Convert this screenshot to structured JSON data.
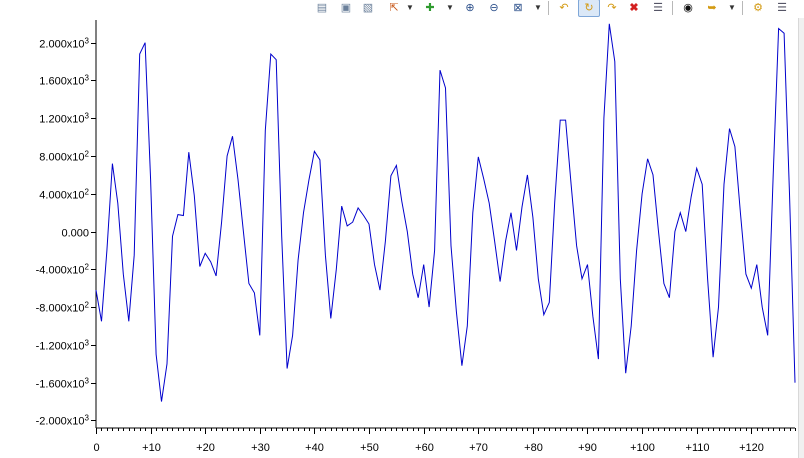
{
  "toolbar": {
    "icons": [
      "align-left-icon",
      "align-center-icon",
      "align-bottom-icon",
      "cursor-icon",
      "add-icon",
      "zoom-in-icon",
      "zoom-out-icon",
      "zoom-fit-icon",
      "undo-icon",
      "refresh-icon",
      "delete-icon",
      "list-icon",
      "binoculars-icon",
      "export-icon",
      "options-icon"
    ]
  },
  "colors": {
    "series": "#0000cc",
    "axis": "#000000"
  },
  "chart_data": {
    "type": "line",
    "xlim": [
      0,
      128
    ],
    "ylim": [
      -2080,
      2240
    ],
    "x_ticks": [
      0,
      10,
      20,
      30,
      40,
      50,
      60,
      70,
      80,
      90,
      100,
      110,
      120
    ],
    "x_tick_labels": [
      "0",
      "+10",
      "+20",
      "+30",
      "+40",
      "+50",
      "+60",
      "+70",
      "+80",
      "+90",
      "+100",
      "+110",
      "+120"
    ],
    "y_ticks": [
      2000,
      1600,
      1200,
      800,
      400,
      0,
      -400,
      -800,
      -1200,
      -1600,
      -2000
    ],
    "y_tick_labels": [
      {
        "m": "2.000x10",
        "e": "3"
      },
      {
        "m": "1.600x10",
        "e": "3"
      },
      {
        "m": "1.200x10",
        "e": "3"
      },
      {
        "m": "8.000x10",
        "e": "2"
      },
      {
        "m": "4.000x10",
        "e": "2"
      },
      {
        "m": "0.000",
        "e": ""
      },
      {
        "m": "-4.000x10",
        "e": "2"
      },
      {
        "m": "-8.000x10",
        "e": "2"
      },
      {
        "m": "-1.200x10",
        "e": "3"
      },
      {
        "m": "-1.600x10",
        "e": "3"
      },
      {
        "m": "-2.000x10",
        "e": "3"
      }
    ],
    "series": [
      {
        "values": [
          -620,
          -950,
          -200,
          720,
          300,
          -450,
          -950,
          -250,
          1880,
          2000,
          550,
          -1300,
          -1800,
          -1400,
          -50,
          180,
          170,
          840,
          380,
          -370,
          -230,
          -320,
          -470,
          100,
          800,
          1010,
          550,
          0,
          -550,
          -650,
          -1100,
          1070,
          1880,
          1820,
          -50,
          -1450,
          -1100,
          -300,
          200,
          550,
          850,
          760,
          -250,
          -920,
          -400,
          270,
          60,
          100,
          250,
          170,
          80,
          -350,
          -620,
          -100,
          590,
          700,
          320,
          0,
          -450,
          -700,
          -350,
          -800,
          -200,
          1710,
          1520,
          -150,
          -850,
          -1420,
          -1000,
          200,
          790,
          560,
          300,
          -100,
          -530,
          -100,
          200,
          -200,
          260,
          600,
          150,
          -500,
          -880,
          -750,
          310,
          1180,
          1180,
          500,
          -150,
          -500,
          -350,
          -900,
          -1350,
          1200,
          2200,
          1800,
          -500,
          -1500,
          -1000,
          -200,
          400,
          770,
          600,
          0,
          -550,
          -700,
          0,
          200,
          0,
          370,
          670,
          500,
          -500,
          -1330,
          -800,
          500,
          1090,
          900,
          200,
          -450,
          -600,
          -350,
          -800,
          -1100,
          600,
          2150,
          2100,
          400,
          -1600
        ]
      }
    ]
  }
}
